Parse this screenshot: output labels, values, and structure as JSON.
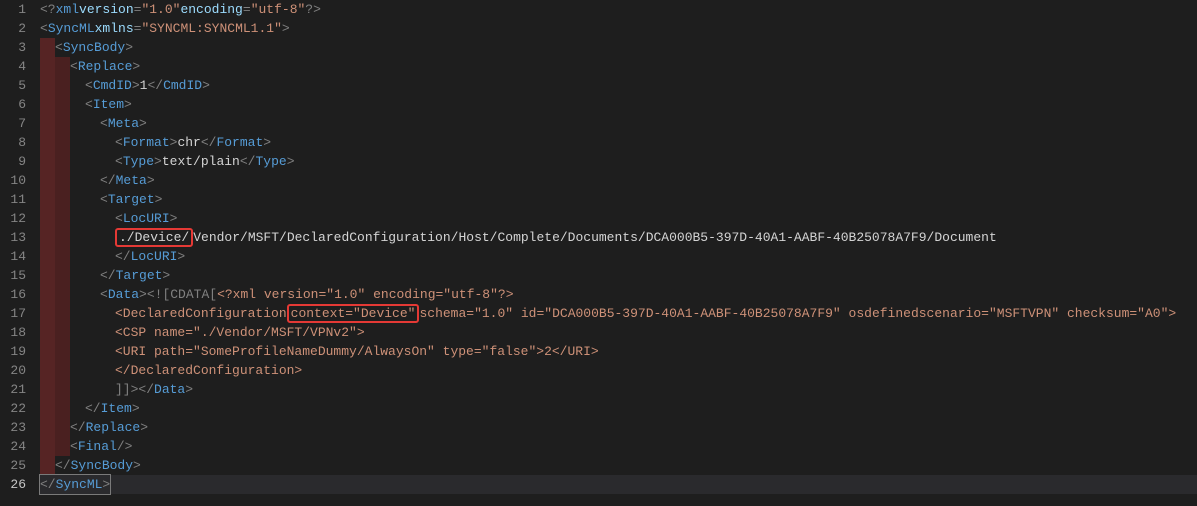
{
  "lines": [
    {
      "n": 1,
      "indent": 0,
      "dirty": 0,
      "tokens": [
        {
          "c": "delim",
          "t": "<?"
        },
        {
          "c": "tag",
          "t": "xml"
        },
        {
          "c": "txt",
          "t": " "
        },
        {
          "c": "attr",
          "t": "version"
        },
        {
          "c": "delim",
          "t": "="
        },
        {
          "c": "val",
          "t": "\"1.0\""
        },
        {
          "c": "txt",
          "t": " "
        },
        {
          "c": "attr",
          "t": "encoding"
        },
        {
          "c": "delim",
          "t": "="
        },
        {
          "c": "val",
          "t": "\"utf-8\""
        },
        {
          "c": "delim",
          "t": "?>"
        }
      ]
    },
    {
      "n": 2,
      "indent": 0,
      "dirty": 0,
      "tokens": [
        {
          "c": "delim",
          "t": "<"
        },
        {
          "c": "tag",
          "t": "SyncML"
        },
        {
          "c": "txt",
          "t": " "
        },
        {
          "c": "attr",
          "t": "xmlns"
        },
        {
          "c": "delim",
          "t": "="
        },
        {
          "c": "val",
          "t": "\"SYNCML:SYNCML1.1\""
        },
        {
          "c": "delim",
          "t": ">"
        }
      ]
    },
    {
      "n": 3,
      "indent": 1,
      "dirty": 1,
      "tokens": [
        {
          "c": "delim",
          "t": "<"
        },
        {
          "c": "tag",
          "t": "SyncBody"
        },
        {
          "c": "delim",
          "t": ">"
        }
      ]
    },
    {
      "n": 4,
      "indent": 2,
      "dirty": 2,
      "tokens": [
        {
          "c": "delim",
          "t": "<"
        },
        {
          "c": "tag",
          "t": "Replace"
        },
        {
          "c": "delim",
          "t": ">"
        }
      ]
    },
    {
      "n": 5,
      "indent": 3,
      "dirty": 2,
      "tokens": [
        {
          "c": "delim",
          "t": "<"
        },
        {
          "c": "tag",
          "t": "CmdID"
        },
        {
          "c": "delim",
          "t": ">"
        },
        {
          "c": "txt",
          "t": "1"
        },
        {
          "c": "delim",
          "t": "</"
        },
        {
          "c": "tag",
          "t": "CmdID"
        },
        {
          "c": "delim",
          "t": ">"
        }
      ]
    },
    {
      "n": 6,
      "indent": 3,
      "dirty": 2,
      "tokens": [
        {
          "c": "delim",
          "t": "<"
        },
        {
          "c": "tag",
          "t": "Item"
        },
        {
          "c": "delim",
          "t": ">"
        }
      ]
    },
    {
      "n": 7,
      "indent": 4,
      "dirty": 2,
      "tokens": [
        {
          "c": "delim",
          "t": "<"
        },
        {
          "c": "tag",
          "t": "Meta"
        },
        {
          "c": "delim",
          "t": ">"
        }
      ]
    },
    {
      "n": 8,
      "indent": 5,
      "dirty": 2,
      "tokens": [
        {
          "c": "delim",
          "t": "<"
        },
        {
          "c": "tag",
          "t": "Format"
        },
        {
          "c": "delim",
          "t": ">"
        },
        {
          "c": "txt",
          "t": "chr"
        },
        {
          "c": "delim",
          "t": "</"
        },
        {
          "c": "tag",
          "t": "Format"
        },
        {
          "c": "delim",
          "t": ">"
        }
      ]
    },
    {
      "n": 9,
      "indent": 5,
      "dirty": 2,
      "tokens": [
        {
          "c": "delim",
          "t": "<"
        },
        {
          "c": "tag",
          "t": "Type"
        },
        {
          "c": "delim",
          "t": ">"
        },
        {
          "c": "txt",
          "t": "text/plain"
        },
        {
          "c": "delim",
          "t": "</"
        },
        {
          "c": "tag",
          "t": "Type"
        },
        {
          "c": "delim",
          "t": ">"
        }
      ]
    },
    {
      "n": 10,
      "indent": 4,
      "dirty": 2,
      "tokens": [
        {
          "c": "delim",
          "t": "</"
        },
        {
          "c": "tag",
          "t": "Meta"
        },
        {
          "c": "delim",
          "t": ">"
        }
      ]
    },
    {
      "n": 11,
      "indent": 4,
      "dirty": 2,
      "tokens": [
        {
          "c": "delim",
          "t": "<"
        },
        {
          "c": "tag",
          "t": "Target"
        },
        {
          "c": "delim",
          "t": ">"
        }
      ]
    },
    {
      "n": 12,
      "indent": 5,
      "dirty": 2,
      "tokens": [
        {
          "c": "delim",
          "t": "<"
        },
        {
          "c": "tag",
          "t": "LocURI"
        },
        {
          "c": "delim",
          "t": ">"
        }
      ]
    },
    {
      "n": 13,
      "indent": 5,
      "dirty": 2,
      "tokens": [
        {
          "c": "txt",
          "box": true,
          "t": "./Device/"
        },
        {
          "c": "txt",
          "t": "Vendor/MSFT/DeclaredConfiguration/Host/Complete/Documents/DCA000B5-397D-40A1-AABF-40B25078A7F9/Document"
        }
      ]
    },
    {
      "n": 14,
      "indent": 5,
      "dirty": 2,
      "tokens": [
        {
          "c": "delim",
          "t": "</"
        },
        {
          "c": "tag",
          "t": "LocURI"
        },
        {
          "c": "delim",
          "t": ">"
        }
      ]
    },
    {
      "n": 15,
      "indent": 4,
      "dirty": 2,
      "tokens": [
        {
          "c": "delim",
          "t": "</"
        },
        {
          "c": "tag",
          "t": "Target"
        },
        {
          "c": "delim",
          "t": ">"
        }
      ]
    },
    {
      "n": 16,
      "indent": 4,
      "dirty": 2,
      "tokens": [
        {
          "c": "delim",
          "t": "<"
        },
        {
          "c": "tag",
          "t": "Data"
        },
        {
          "c": "delim",
          "t": ">"
        },
        {
          "c": "cdata",
          "t": "<![CDATA["
        },
        {
          "c": "val",
          "t": "<?xml version=\"1.0\" encoding=\"utf-8\"?>"
        }
      ]
    },
    {
      "n": 17,
      "indent": 5,
      "dirty": 2,
      "tokens": [
        {
          "c": "val",
          "t": "<DeclaredConfiguration "
        },
        {
          "c": "val",
          "box": true,
          "t": "context=\"Device\""
        },
        {
          "c": "val",
          "t": " schema=\"1.0\" id=\"DCA000B5-397D-40A1-AABF-40B25078A7F9\" osdefinedscenario=\"MSFTVPN\" checksum=\"A0\">"
        }
      ]
    },
    {
      "n": 18,
      "indent": 5,
      "dirty": 2,
      "tokens": [
        {
          "c": "val",
          "t": "  <CSP name=\"./Vendor/MSFT/VPNv2\">"
        }
      ]
    },
    {
      "n": 19,
      "indent": 5,
      "dirty": 2,
      "tokens": [
        {
          "c": "val",
          "t": "    <URI path=\"SomeProfileNameDummy/AlwaysOn\" type=\"false\">2</URI>"
        }
      ]
    },
    {
      "n": 20,
      "indent": 5,
      "dirty": 2,
      "tokens": [
        {
          "c": "val",
          "t": "</DeclaredConfiguration>"
        }
      ]
    },
    {
      "n": 21,
      "indent": 5,
      "dirty": 2,
      "tokens": [
        {
          "c": "cdata",
          "t": "]]>"
        },
        {
          "c": "delim",
          "t": "</"
        },
        {
          "c": "tag",
          "t": "Data"
        },
        {
          "c": "delim",
          "t": ">"
        }
      ]
    },
    {
      "n": 22,
      "indent": 3,
      "dirty": 2,
      "tokens": [
        {
          "c": "delim",
          "t": "</"
        },
        {
          "c": "tag",
          "t": "Item"
        },
        {
          "c": "delim",
          "t": ">"
        }
      ]
    },
    {
      "n": 23,
      "indent": 2,
      "dirty": 2,
      "tokens": [
        {
          "c": "delim",
          "t": "</"
        },
        {
          "c": "tag",
          "t": "Replace"
        },
        {
          "c": "delim",
          "t": ">"
        }
      ]
    },
    {
      "n": 24,
      "indent": 2,
      "dirty": 2,
      "tokens": [
        {
          "c": "delim",
          "t": "<"
        },
        {
          "c": "tag",
          "t": "Final"
        },
        {
          "c": "txt",
          "t": " "
        },
        {
          "c": "delim",
          "t": "/>"
        }
      ]
    },
    {
      "n": 25,
      "indent": 1,
      "dirty": 1,
      "tokens": [
        {
          "c": "delim",
          "t": "</"
        },
        {
          "c": "tag",
          "t": "SyncBody"
        },
        {
          "c": "delim",
          "t": ">"
        }
      ]
    },
    {
      "n": 26,
      "indent": 0,
      "dirty": 0,
      "active": true,
      "tokens": [
        {
          "c": "delim",
          "cursor": true,
          "t": "</"
        },
        {
          "c": "tag",
          "cursor": true,
          "t": "SyncML"
        },
        {
          "c": "delim",
          "cursor": true,
          "t": ">"
        }
      ]
    }
  ]
}
